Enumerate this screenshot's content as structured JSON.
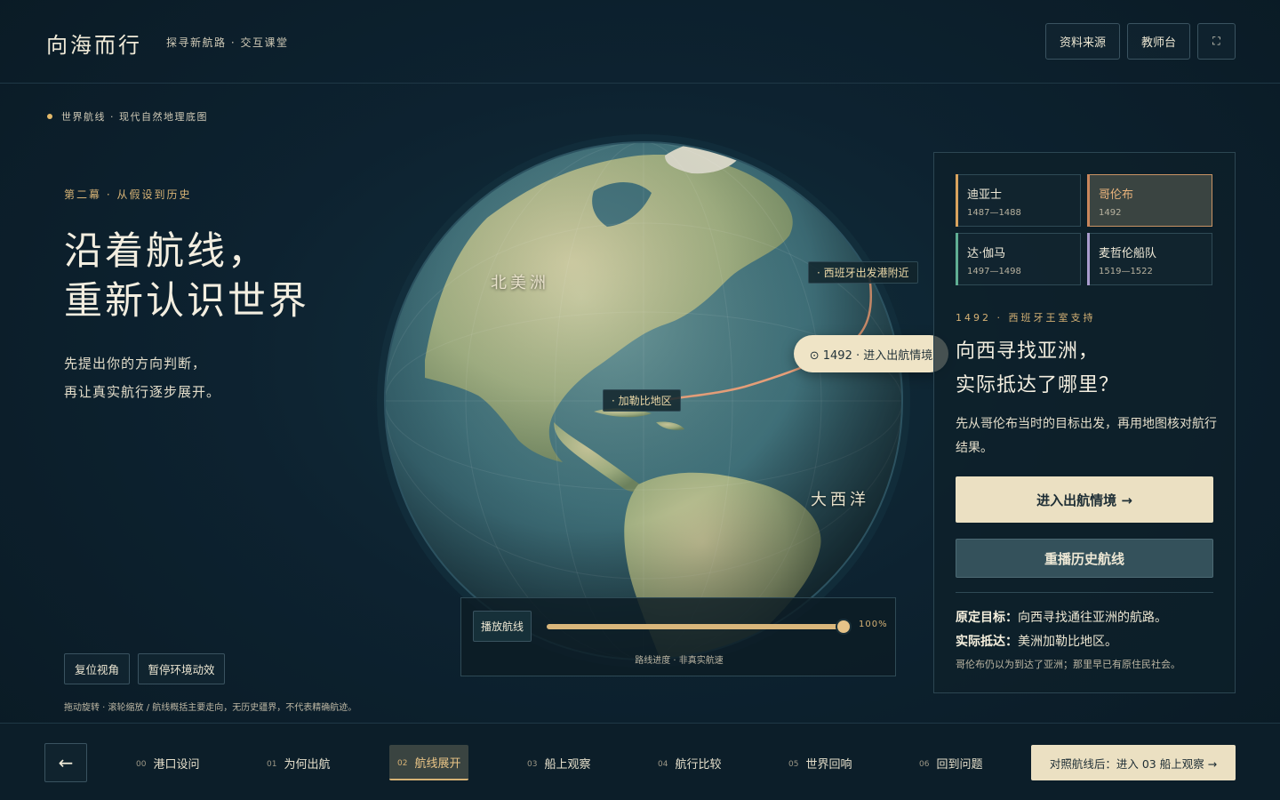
{
  "header": {
    "brand": "向海而行",
    "subtitle": "探寻新航路 · 交互课堂",
    "sources_label": "资料来源",
    "teacher_label": "教师台",
    "fullscreen_icon": "⛶"
  },
  "left": {
    "breadcrumb": "世界航线 · 现代自然地理底图",
    "act": "第二幕 · 从假设到历史",
    "headline": [
      "沿着航线，",
      "重新认识世界"
    ],
    "intro": [
      "先提出你的方向判断，",
      "再让真实航行逐步展开。"
    ],
    "reset_label": "复位视角",
    "pause_label": "暂停环境动效",
    "hint": "拖动旋转 · 滚轮缩放 / 航线概括主要走向，无历史疆界，不代表精确航迹。"
  },
  "globe": {
    "label_north_america": "北美洲",
    "label_atlantic": "大西洋",
    "pin_spain": "· 西班牙出发港附近",
    "pin_caribbean": "· 加勒比地区",
    "pill_label": "⊙ 1492 · 进入出航情境"
  },
  "playback": {
    "play_label": "播放航线",
    "progress": 100,
    "percent_text": "100%",
    "caption": "路线进度 · 非真实航速"
  },
  "voyages": [
    {
      "name": "迪亚士",
      "years": "1487—1488",
      "accent": "#d9a35e",
      "active": false
    },
    {
      "name": "哥伦布",
      "years": "1492",
      "accent": "#c8855c",
      "active": true
    },
    {
      "name": "达·伽马",
      "years": "1497—1498",
      "accent": "#5fae93",
      "active": false
    },
    {
      "name": "麦哲伦船队",
      "years": "1519—1522",
      "accent": "#a99ccd",
      "active": false
    }
  ],
  "panel": {
    "eyebrow": "1492 · 西班牙王室支持",
    "title": [
      "向西寻找亚洲，",
      "实际抵达了哪里？"
    ],
    "desc": "先从哥伦布当时的目标出发，再用地图核对航行结果。",
    "cta": "进入出航情境 →",
    "replay": "重播历史航线",
    "goal_key": "原定目标：",
    "goal_val": "向西寻找通往亚洲的航路。",
    "reach_key": "实际抵达：",
    "reach_val": "美洲加勒比地区。",
    "note": "哥伦布仍以为到达了亚洲；那里早已有原住民社会。"
  },
  "nav": {
    "back_icon": "←",
    "steps": [
      {
        "num": "00",
        "label": "港口设问"
      },
      {
        "num": "01",
        "label": "为何出航"
      },
      {
        "num": "02",
        "label": "航线展开",
        "active": true
      },
      {
        "num": "03",
        "label": "船上观察"
      },
      {
        "num": "04",
        "label": "航行比较"
      },
      {
        "num": "05",
        "label": "世界回响"
      },
      {
        "num": "06",
        "label": "回到问题"
      }
    ],
    "next_label": "对照航线后：进入 03 船上观察 →"
  }
}
